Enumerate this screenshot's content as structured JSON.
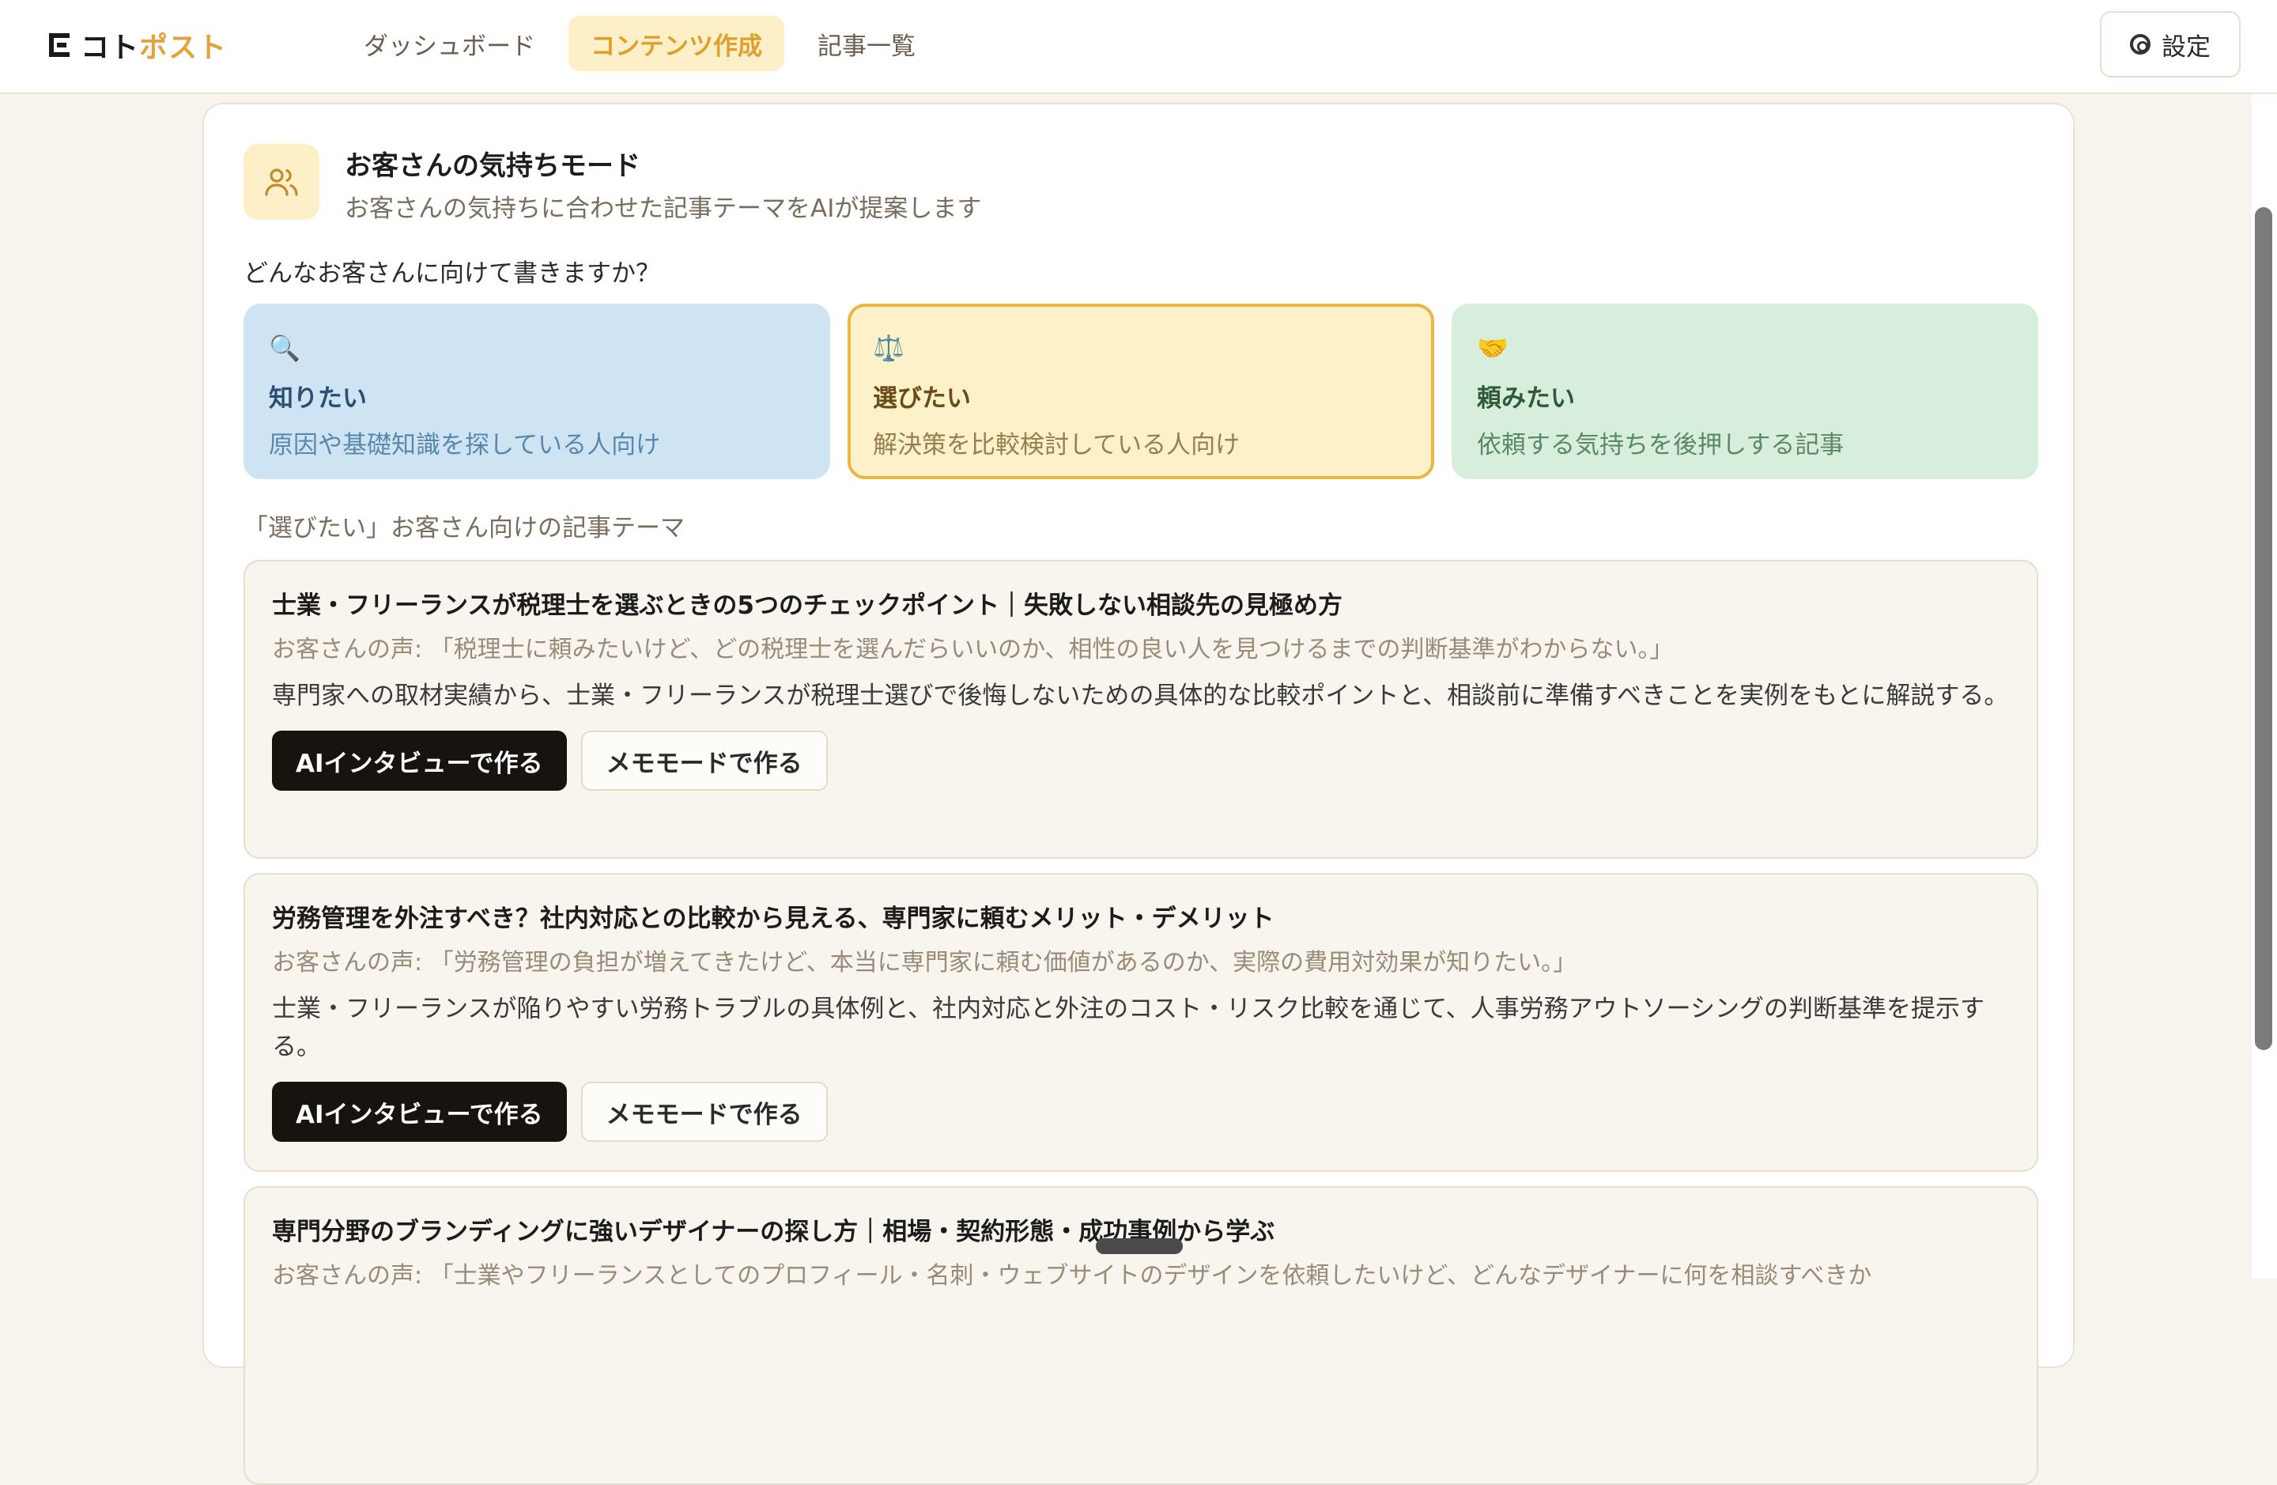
{
  "header": {
    "logo_black": "コト",
    "logo_accent": "ポスト",
    "nav": [
      {
        "label": "ダッシュボード"
      },
      {
        "label": "コンテンツ作成"
      },
      {
        "label": "記事一覧"
      }
    ],
    "active_nav": "コンテンツ作成",
    "settings_label": "設定"
  },
  "mode": {
    "title": "お客さんの気持ちモード",
    "description": "お客さんの気持ちに合わせた記事テーマをAIが提案します",
    "icon": "users-icon"
  },
  "question": "どんなお客さんに向けて書きますか？",
  "personas": [
    {
      "emoji": "🔍",
      "name": "知りたい",
      "desc": "原因や基礎知識を探している人向け"
    },
    {
      "emoji": "⚖️",
      "name": "選びたい",
      "desc": "解決策を比較検討している人向け"
    },
    {
      "emoji": "🤝",
      "name": "頼みたい",
      "desc": "依頼する気持ちを後押しする記事"
    }
  ],
  "selected_persona": "選びたい",
  "section_label": "「選びたい」お客さん向けの記事テーマ",
  "themes": [
    {
      "title": "士業・フリーランスが税理士を選ぶときの5つのチェックポイント｜失敗しない相談先の見極め方",
      "voice": "お客さんの声: 「税理士に頼みたいけど、どの税理士を選んだらいいのか、相性の良い人を見つけるまでの判断基準がわからない。」",
      "summary": "専門家への取材実績から、士業・フリーランスが税理士選びで後悔しないための具体的な比較ポイントと、相談前に準備すべきことを実例をもとに解説する。"
    },
    {
      "title": "労務管理を外注すべき？社内対応との比較から見える、専門家に頼むメリット・デメリット",
      "voice": "お客さんの声: 「労務管理の負担が増えてきたけど、本当に専門家に頼む価値があるのか、実際の費用対効果が知りたい。」",
      "summary": "士業・フリーランスが陥りやすい労務トラブルの具体例と、社内対応と外注のコスト・リスク比較を通じて、人事労務アウトソーシングの判断基準を提示する。"
    },
    {
      "title": "専門分野のブランディングに強いデザイナーの探し方｜相場・契約形態・成功事例から学ぶ",
      "voice": "お客さんの声: 「士業やフリーランスとしてのプロフィール・名刺・ウェブサイトのデザインを依頼したいけど、どんなデザイナーに何を相談すべきか",
      "summary": ""
    }
  ],
  "buttons": {
    "ai_interview": "AIインタビューで作る",
    "memo_mode": "メモモードで作る"
  },
  "colors": {
    "accent": "#e3a33a",
    "active_nav_bg": "#fdefc7",
    "persona_know_bg": "#cfe4f3",
    "persona_choose_bg": "#fcf1c9",
    "persona_choose_border": "#ecb640",
    "persona_request_bg": "#d7eedc",
    "primary_button": "#17140f"
  }
}
